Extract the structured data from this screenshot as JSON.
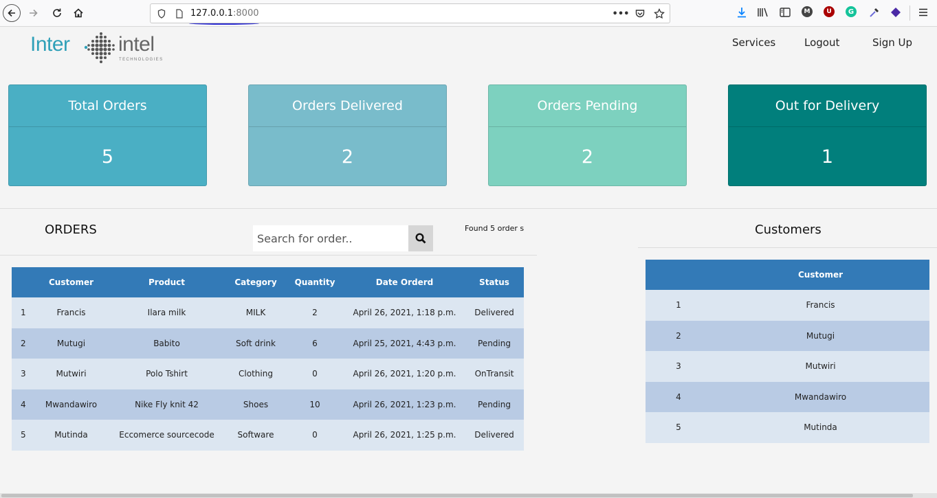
{
  "browser": {
    "url_host": "127.0.0.1",
    "url_port": ":8000"
  },
  "brand": {
    "name_left": "Inter",
    "name_right": "intel",
    "tagline": "TECHNOLOGIES",
    "primary_color": "#2fa0b8"
  },
  "nav": {
    "services": "Services",
    "logout": "Logout",
    "signup": "Sign Up"
  },
  "stats": [
    {
      "label": "Total Orders",
      "value": "5",
      "color": "#4aafc4"
    },
    {
      "label": "Orders Delivered",
      "value": "2",
      "color": "#79bccb"
    },
    {
      "label": "Orders Pending",
      "value": "2",
      "color": "#7dd1bf"
    },
    {
      "label": "Out for Delivery",
      "value": "1",
      "color": "#017f7c"
    }
  ],
  "orders": {
    "title": "ORDERS",
    "search_placeholder": "Search for order..",
    "found_text": "Found 5 order s",
    "columns": [
      "",
      "Customer",
      "Product",
      "Category",
      "Quantity",
      "Date Orderd",
      "Status"
    ],
    "rows": [
      [
        "1",
        "Francis",
        "Ilara milk",
        "MILK",
        "2",
        "April 26, 2021, 1:18 p.m.",
        "Delivered"
      ],
      [
        "2",
        "Mutugi",
        "Babito",
        "Soft drink",
        "6",
        "April 25, 2021, 4:43 p.m.",
        "Pending"
      ],
      [
        "3",
        "Mutwiri",
        "Polo Tshirt",
        "Clothing",
        "0",
        "April 26, 2021, 1:20 p.m.",
        "OnTransit"
      ],
      [
        "4",
        "Mwandawiro",
        "Nike Fly knit 42",
        "Shoes",
        "10",
        "April 26, 2021, 1:23 p.m.",
        "Pending"
      ],
      [
        "5",
        "Mutinda",
        "Eccomerce sourcecode",
        "Software",
        "0",
        "April 26, 2021, 1:25 p.m.",
        "Delivered"
      ]
    ]
  },
  "customers": {
    "title": "Customers",
    "columns": [
      "",
      "Customer"
    ],
    "rows": [
      [
        "1",
        "Francis"
      ],
      [
        "2",
        "Mutugi"
      ],
      [
        "3",
        "Mutwiri"
      ],
      [
        "4",
        "Mwandawiro"
      ],
      [
        "5",
        "Mutinda"
      ]
    ]
  },
  "icons": {
    "back": "back-arrow-icon",
    "forward": "forward-arrow-icon",
    "reload": "reload-icon",
    "home": "home-icon",
    "search": "search-icon"
  }
}
